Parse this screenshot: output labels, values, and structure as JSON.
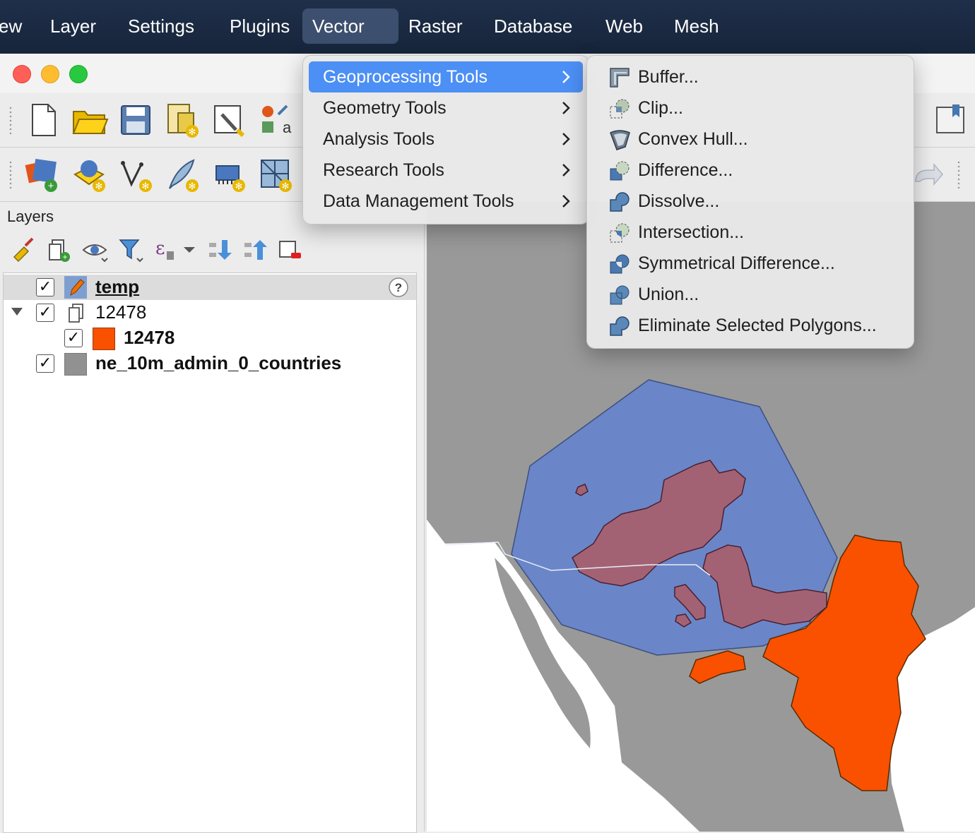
{
  "menubar": {
    "items": [
      {
        "label": "ew",
        "name": "menu-view"
      },
      {
        "label": "Layer",
        "name": "menu-layer"
      },
      {
        "label": "Settings",
        "name": "menu-settings"
      },
      {
        "label": "Plugins",
        "name": "menu-plugins"
      },
      {
        "label": "Vector",
        "name": "menu-vector"
      },
      {
        "label": "Raster",
        "name": "menu-raster"
      },
      {
        "label": "Database",
        "name": "menu-database"
      },
      {
        "label": "Web",
        "name": "menu-web"
      },
      {
        "label": "Mesh",
        "name": "menu-mesh"
      }
    ],
    "active": "Vector"
  },
  "vector_menu": {
    "items": [
      {
        "label": "Geoprocessing Tools",
        "highlighted": true
      },
      {
        "label": "Geometry Tools"
      },
      {
        "label": "Analysis Tools"
      },
      {
        "label": "Research Tools"
      },
      {
        "label": "Data Management Tools"
      }
    ]
  },
  "geoprocessing_submenu": {
    "items": [
      {
        "label": "Buffer...",
        "icon": "buffer-icon"
      },
      {
        "label": "Clip...",
        "icon": "clip-icon"
      },
      {
        "label": "Convex Hull...",
        "icon": "convex-hull-icon"
      },
      {
        "label": "Difference...",
        "icon": "difference-icon"
      },
      {
        "label": "Dissolve...",
        "icon": "dissolve-icon"
      },
      {
        "label": "Intersection...",
        "icon": "intersection-icon"
      },
      {
        "label": "Symmetrical Difference...",
        "icon": "symmetrical-difference-icon"
      },
      {
        "label": "Union...",
        "icon": "union-icon"
      },
      {
        "label": "Eliminate Selected Polygons...",
        "icon": "eliminate-icon"
      }
    ]
  },
  "layers_panel": {
    "title": "Layers",
    "layers": [
      {
        "name": "temp",
        "checked": true,
        "bold": true,
        "underline": true,
        "icon": "pencil-edit-icon",
        "selected": true,
        "indicator": "unknown-crs-icon"
      },
      {
        "name": "12478",
        "checked": true,
        "bold": false,
        "icon": "group-icon",
        "expanded": true
      },
      {
        "name": "12478",
        "checked": true,
        "bold": true,
        "swatch": "#f95100"
      },
      {
        "name": "ne_10m_admin_0_countries",
        "checked": true,
        "bold": true,
        "swatch": "#919191"
      }
    ]
  },
  "colors": {
    "menubar": "#1f2f4a",
    "highlight": "#4c8ff5",
    "land": "#999999",
    "hull": "#6a86c8",
    "layer_orange": "#f95100",
    "intersection": "#a36274"
  },
  "checkmark": "✓"
}
